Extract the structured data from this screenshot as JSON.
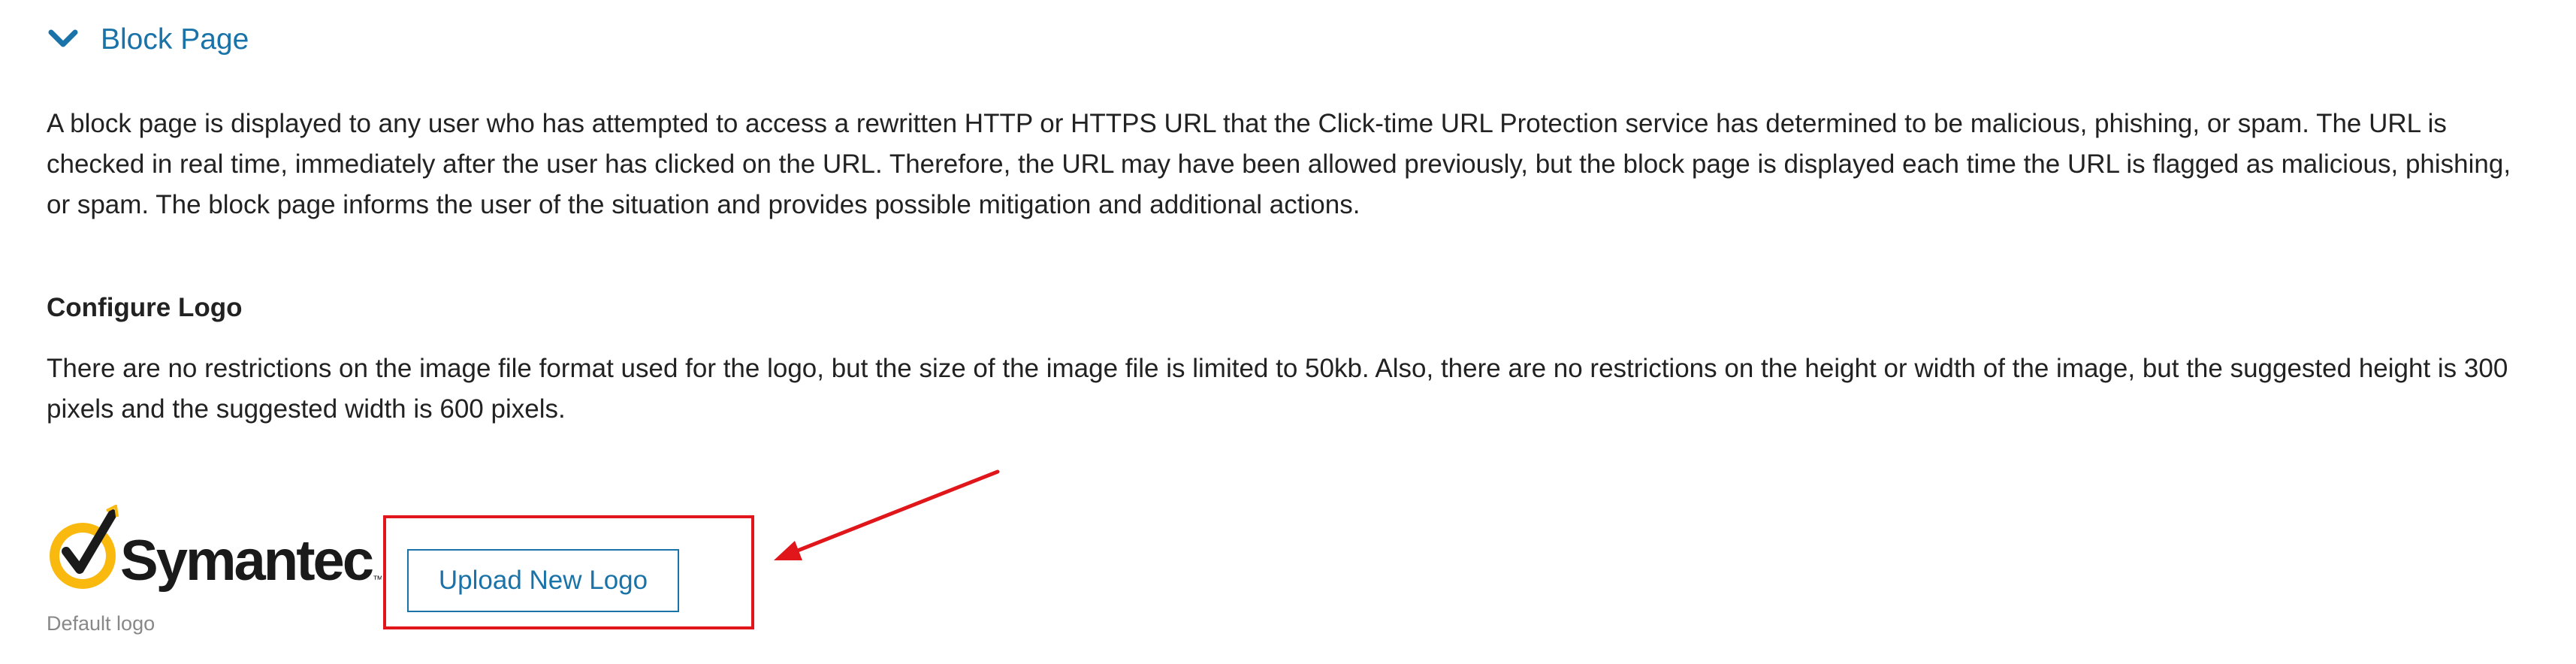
{
  "section": {
    "title": "Block Page",
    "chevron_icon": "chevron-down-icon",
    "accent_color": "#1a73a8"
  },
  "intro": {
    "text": "A block page is displayed to any user who has attempted to access a rewritten HTTP or HTTPS URL that the Click-time URL Protection service has determined to be malicious, phishing, or spam. The URL is checked in real time, immediately after the user has clicked on the URL. Therefore, the URL may have been allowed previously, but the block page is displayed each time the URL is flagged as malicious, phishing, or spam. The block page informs the user of the situation and provides possible mitigation and additional actions."
  },
  "configure_logo": {
    "heading": "Configure Logo",
    "description": "There are no restrictions on the image file format used for the logo, but the size of the image file is limited to 50kb. Also, there are no restrictions on the height or width of the image, but the suggested height is 300 pixels and the suggested width is 600 pixels.",
    "logo": {
      "brand_text": "Symantec",
      "trademark": "™",
      "caption": "Default logo",
      "brand_color": "#f9b90f"
    },
    "upload_button_label": "Upload New Logo"
  },
  "annotation": {
    "highlight_color": "#e0161b",
    "arrow_icon": "red-arrow-icon"
  }
}
